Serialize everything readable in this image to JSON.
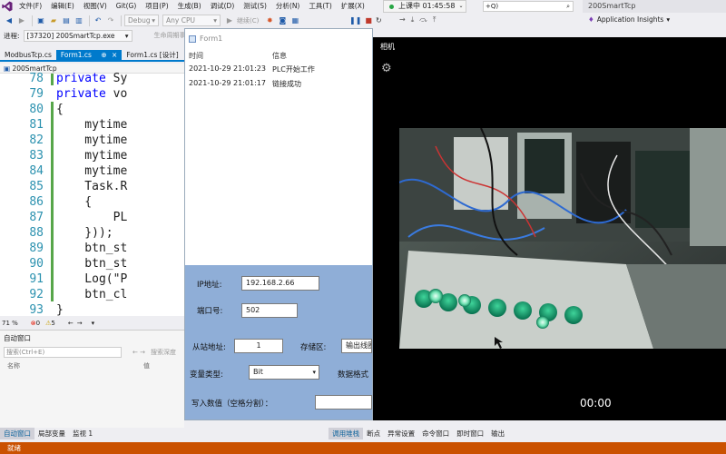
{
  "menubar": {
    "items": [
      "文件(F)",
      "编辑(E)",
      "视图(V)",
      "Git(G)",
      "项目(P)",
      "生成(B)",
      "调试(D)",
      "测试(S)",
      "分析(N)",
      "工具(T)",
      "扩展(X)"
    ],
    "search_tail": "+Q)",
    "project_name": "200SmartTcp"
  },
  "recording": {
    "label": "上课中 01:45:58"
  },
  "toolbar": {
    "config": "Debug",
    "platform": "Any CPU",
    "continue": "继续(C)",
    "app_insights": "Application Insights"
  },
  "procbar": {
    "label": "进程:",
    "process": "[37320] 200SmartTcp.exe",
    "lifecycle": "生命周期事件"
  },
  "tabs": [
    {
      "label": "ModbusTcp.cs",
      "active": false
    },
    {
      "label": "Form1.cs",
      "active": true
    },
    {
      "label": "Form1.cs [设计]",
      "active": false
    }
  ],
  "editor": {
    "breadcrumb": "200SmartTcp",
    "lines": [
      {
        "num": "78",
        "code": "private Sy"
      },
      {
        "num": "79",
        "code": "private vo"
      },
      {
        "num": "80",
        "code": "{"
      },
      {
        "num": "81",
        "code": "    mytime"
      },
      {
        "num": "82",
        "code": "    mytime"
      },
      {
        "num": "83",
        "code": "    mytime"
      },
      {
        "num": "84",
        "code": "    mytime"
      },
      {
        "num": "85",
        "code": "    Task.R"
      },
      {
        "num": "86",
        "code": "    {"
      },
      {
        "num": "87",
        "code": "        PL"
      },
      {
        "num": "88",
        "code": "    }));"
      },
      {
        "num": "89",
        "code": "    btn_st"
      },
      {
        "num": "90",
        "code": "    btn_st"
      },
      {
        "num": "91",
        "code": "    Log(\"P"
      },
      {
        "num": "92",
        "code": "    btn_cl"
      },
      {
        "num": "93",
        "code": "}"
      }
    ],
    "zoom": "71 %",
    "errors": "0",
    "warnings": "5"
  },
  "autopanel": {
    "title": "自动窗口",
    "search_placeholder": "搜索(Ctrl+E)",
    "search_depth": "搜索深度",
    "col_name": "名称",
    "col_value": "值"
  },
  "bottom_tabs": [
    "自动窗口",
    "局部变量",
    "监视 1"
  ],
  "bottom_tabs_right": [
    "调用堆栈",
    "断点",
    "异常设置",
    "命令窗口",
    "即时窗口",
    "输出"
  ],
  "status": "就绪",
  "form1": {
    "title": "Form1",
    "log_headers": {
      "time": "时间",
      "info": "信息"
    },
    "logs": [
      {
        "time": "2021-10-29 21:01:23",
        "info": "PLC开始工作"
      },
      {
        "time": "2021-10-29 21:01:17",
        "info": "链接成功"
      }
    ],
    "ip_label": "IP地址:",
    "ip_value": "192.168.2.66",
    "port_label": "端口号:",
    "port_value": "502",
    "slave_label": "从站地址:",
    "slave_value": "1",
    "storage_label": "存储区:",
    "storage_value": "输出线圈",
    "vartype_label": "变量类型:",
    "vartype_value": "Bit",
    "dataformat_label": "数据格式",
    "write_label": "写入数值（空格分割）："
  },
  "camera": {
    "title": "相机",
    "time": "00:00"
  }
}
